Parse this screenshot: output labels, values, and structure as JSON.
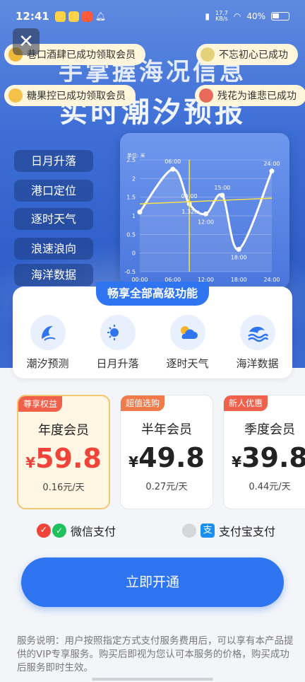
{
  "status": {
    "time": "12:41",
    "net_top": "17.7",
    "net_bottom": "KB/s",
    "battery": "40%"
  },
  "headline": {
    "line1": "手掌握海况信息",
    "line2": "实时潮汐预报"
  },
  "toasts": [
    {
      "text": "巷口酒肆已成功领取会员"
    },
    {
      "text": "不忘初心已成功"
    },
    {
      "text": "糖果控已成功领取会员"
    },
    {
      "text": "残花为谁悲已成功"
    }
  ],
  "feature_tags": [
    "日月升落",
    "港口定位",
    "逐时天气",
    "浪速浪向",
    "海洋数据"
  ],
  "chart_data": {
    "type": "line",
    "ylabel": "单位: 米",
    "x_ticks": [
      "00:00",
      "06:00",
      "12:00",
      "18:00",
      "24:00"
    ],
    "y_ticks": [
      "-0.5",
      "0",
      "0.5",
      "1",
      "1.5",
      "2",
      "2.5"
    ],
    "ylim": [
      -0.5,
      2.5
    ],
    "x_hours": [
      0,
      6,
      9,
      12,
      15,
      18,
      24
    ],
    "values": [
      1.1,
      2.25,
      1.32,
      1.05,
      1.55,
      0.1,
      2.2
    ],
    "point_labels": [
      "",
      "06:00",
      "09:00",
      "12:00",
      "15:00",
      "18:00",
      "24:00"
    ],
    "cursor_label": "1.32m",
    "cursor_time": "09:00"
  },
  "panel": {
    "title": "畅享全部高级功能",
    "items": [
      {
        "label": "潮汐预测",
        "icon": "wave-icon"
      },
      {
        "label": "日月升落",
        "icon": "sun-moon-icon"
      },
      {
        "label": "逐时天气",
        "icon": "weather-icon"
      },
      {
        "label": "海洋数据",
        "icon": "ocean-icon"
      }
    ]
  },
  "plans": [
    {
      "badge": "尊享权益",
      "name": "年度会员",
      "currency": "¥",
      "price": "59.8",
      "per_day": "0.16元/天",
      "selected": true
    },
    {
      "badge": "超值选购",
      "name": "半年会员",
      "currency": "¥",
      "price": "49.8",
      "per_day": "0.27元/天",
      "selected": false
    },
    {
      "badge": "新人优惠",
      "name": "季度会员",
      "currency": "¥",
      "price": "39.8",
      "per_day": "0.44元/天",
      "selected": false
    }
  ],
  "payment": {
    "wechat": "微信支付",
    "alipay": "支付宝支付"
  },
  "cta": "立即开通",
  "note": "服务说明：用户按照指定方式支付服务费用后，可以享有本产品提供的VIP专享服务。购买后即视为您认可本服务的价格，购买成功后服务即时生效。",
  "colors": {
    "accent": "#2f74f0",
    "price_red": "#f0433a",
    "selected_border": "#f3c671"
  }
}
